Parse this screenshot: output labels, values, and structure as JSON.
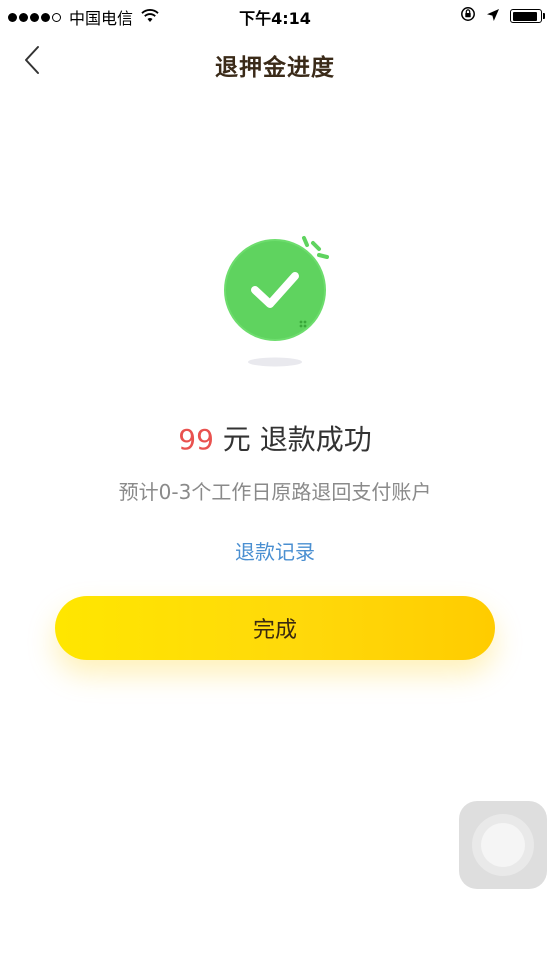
{
  "status_bar": {
    "carrier": "中国电信",
    "time": "下午4:14",
    "signal_bars_filled": 4,
    "signal_bars_total": 5,
    "battery_level": 0.9
  },
  "nav": {
    "title": "退押金进度"
  },
  "result": {
    "amount": "99",
    "currency": "元",
    "status_text": "退款成功",
    "note": "预计0-3个工作日原路退回支付账户",
    "record_link": "退款记录",
    "done_button": "完成"
  },
  "colors": {
    "accent_yellow": "#ffd90a",
    "success_green": "#5fd35f",
    "amount_red": "#e9524f",
    "link_blue": "#4a8fd1"
  },
  "icons": {
    "back": "chevron-left-icon",
    "success": "check-circle-icon",
    "wifi": "wifi-icon",
    "orientation_lock": "orientation-lock-icon",
    "location": "location-arrow-icon",
    "battery": "battery-icon"
  }
}
